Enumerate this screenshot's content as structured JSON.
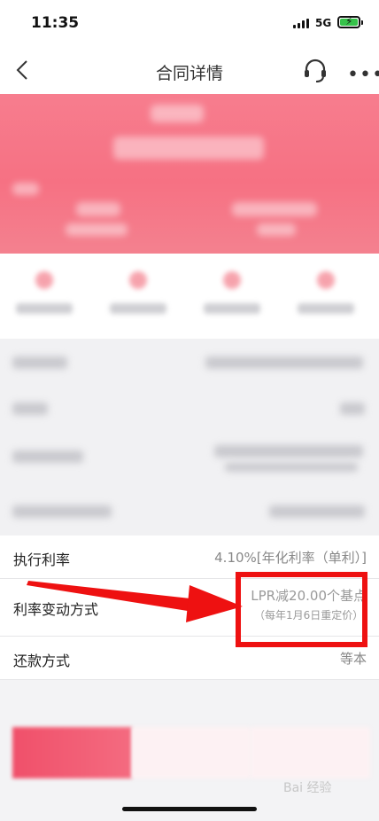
{
  "status_bar": {
    "time": "11:35",
    "network": "5G"
  },
  "header": {
    "title": "合同详情"
  },
  "details": [
    {
      "label": "执行利率",
      "value": "4.10%[年化利率（单利）]"
    },
    {
      "label": "利率变动方式",
      "value": "LPR减20.00个基点",
      "note": "（每年1月6日重定价）"
    },
    {
      "label": "还款方式",
      "value": "等本"
    }
  ],
  "watermark": "Bai 经验",
  "icons": {
    "back": "chevron-left-icon",
    "support": "headset-icon",
    "more": "more-dots-icon",
    "signal": "signal-bars-icon",
    "battery": "battery-charging-icon"
  },
  "colors": {
    "hero": "#f67183",
    "highlight": "#ee1111",
    "primary_button": "#f0506a"
  }
}
